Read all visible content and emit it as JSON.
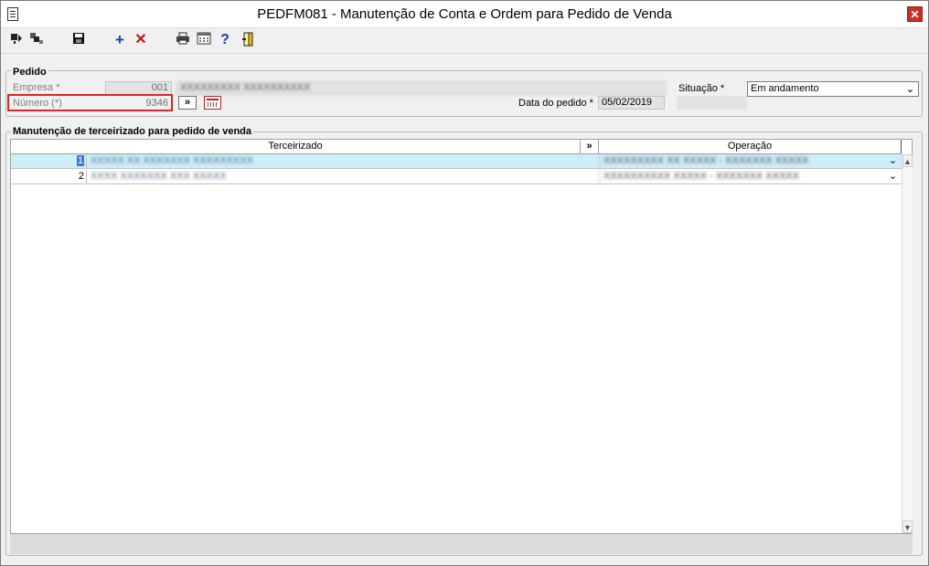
{
  "window": {
    "title": "PEDFM081 - Manutenção de Conta e Ordem para Pedido de Venda",
    "close_label": "✕"
  },
  "toolbar": {
    "icons": [
      "navigate-first-icon",
      "navigate-record-icon",
      "save-icon",
      "add-icon",
      "delete-icon",
      "print-icon",
      "calculator-icon",
      "help-icon",
      "exit-door-icon"
    ],
    "add_glyph": "+",
    "delete_glyph": "✕",
    "help_glyph": "?"
  },
  "pedido": {
    "group_label": "Pedido",
    "empresa_label": "Empresa *",
    "empresa_value": "001",
    "empresa_name": "XXXXXXXXX XXXXXXXXXX",
    "numero_label": "Número (*)",
    "numero_value": "9346",
    "expand_button": "»",
    "data_pedido_label": "Data do pedido *",
    "data_pedido_value": "05/02/2019",
    "situacao_label": "Situação *",
    "situacao_value": "Em andamento"
  },
  "terceirizado": {
    "group_label": "Manutenção de terceirizado para pedido de venda",
    "columns": {
      "terceirizado": "Terceirizado",
      "expand": "»",
      "operacao": "Operação"
    },
    "rows": [
      {
        "num": "1",
        "name": "XXXXX XX XXXXXXX XXXXXXXXX",
        "operacao": "XXXXXXXXX XX XXXXX - XXXXXXX XXXXX"
      },
      {
        "num": "2",
        "name": "XXXX XXXXXXX XXX XXXXX",
        "operacao": "XXXXXXXXXX XXXXX - XXXXXXX XXXXX"
      }
    ]
  },
  "colors": {
    "selected_row": "#cdeef9",
    "highlight_border": "#d9262a",
    "close_button": "#c8302a"
  }
}
